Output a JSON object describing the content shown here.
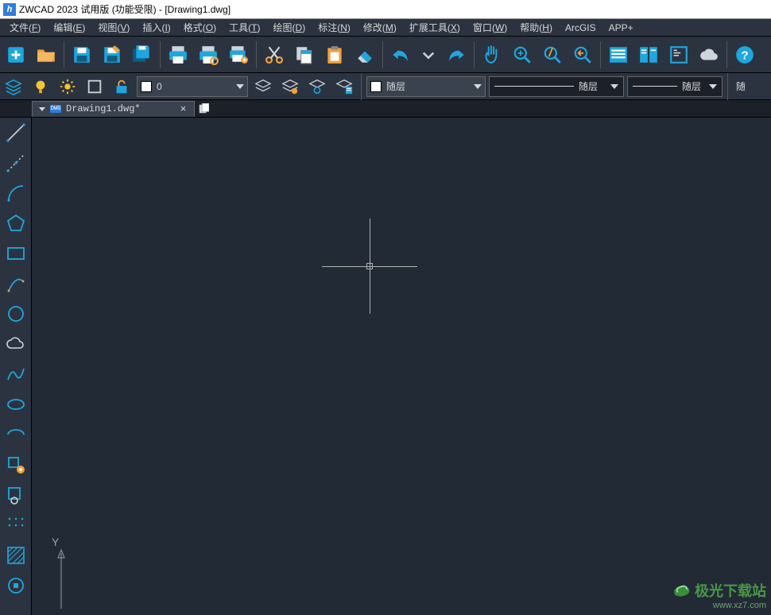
{
  "titlebar": {
    "text": "ZWCAD 2023 试用版 (功能受限) - [Drawing1.dwg]"
  },
  "menu": [
    {
      "label": "文件",
      "key": "F"
    },
    {
      "label": "编辑",
      "key": "E"
    },
    {
      "label": "视图",
      "key": "V"
    },
    {
      "label": "插入",
      "key": "I"
    },
    {
      "label": "格式",
      "key": "O"
    },
    {
      "label": "工具",
      "key": "T"
    },
    {
      "label": "绘图",
      "key": "D"
    },
    {
      "label": "标注",
      "key": "N"
    },
    {
      "label": "修改",
      "key": "M"
    },
    {
      "label": "扩展工具",
      "key": "X"
    },
    {
      "label": "窗口",
      "key": "W"
    },
    {
      "label": "帮助",
      "key": "H"
    },
    {
      "label": "ArcGIS",
      "key": ""
    },
    {
      "label": "APP+",
      "key": ""
    }
  ],
  "layer_combo": {
    "value": "0"
  },
  "color_combo": {
    "label": "随层"
  },
  "ltype_combo": {
    "label": "随层"
  },
  "lw_combo": {
    "label": "随层"
  },
  "lw_combo2": {
    "label": "随"
  },
  "tab": {
    "name": "Drawing1.dwg*",
    "doc_badge": "DWG"
  },
  "ucs": {
    "y": "Y"
  },
  "watermark": {
    "line1": "极光下载站",
    "line2": "www.xz7.com"
  }
}
